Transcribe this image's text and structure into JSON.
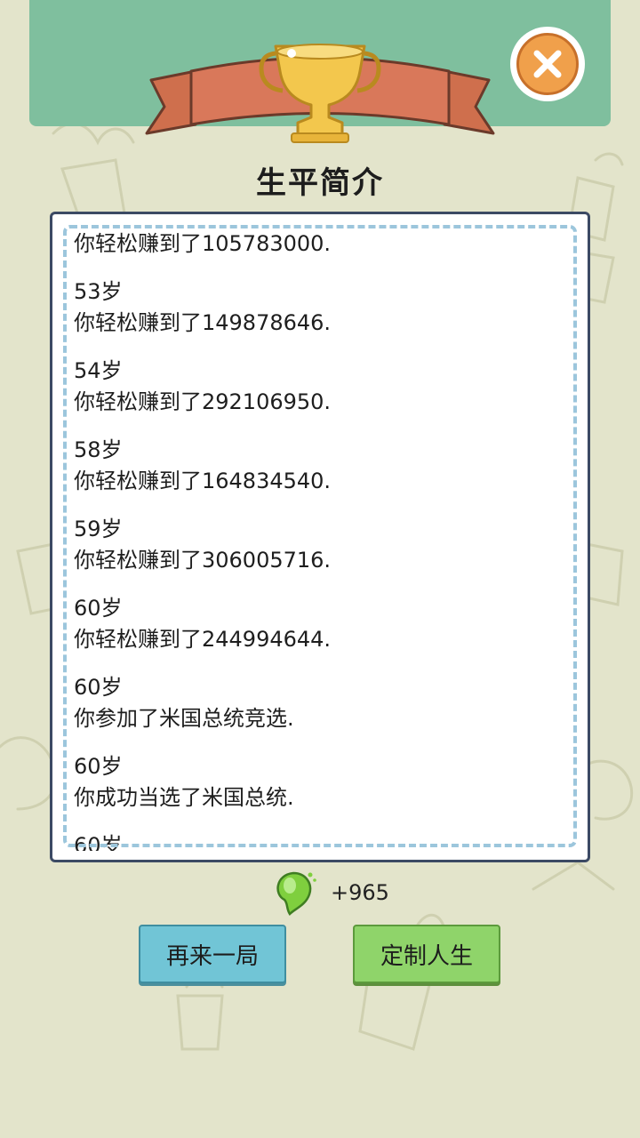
{
  "header": {
    "title": "生平简介"
  },
  "timeline": [
    {
      "age": "",
      "event": "你轻松赚到了105783000."
    },
    {
      "age": "53岁",
      "event": "你轻松赚到了149878646."
    },
    {
      "age": "54岁",
      "event": "你轻松赚到了292106950."
    },
    {
      "age": "58岁",
      "event": "你轻松赚到了164834540."
    },
    {
      "age": "59岁",
      "event": "你轻松赚到了306005716."
    },
    {
      "age": "60岁",
      "event": "你轻松赚到了244994644."
    },
    {
      "age": "60岁",
      "event": "你参加了米国总统竞选."
    },
    {
      "age": "60岁",
      "event": "你成功当选了米国总统."
    },
    {
      "age": "60岁",
      "event": ""
    }
  ],
  "reward": {
    "value": "+965",
    "icon": "green-bean-icon"
  },
  "buttons": {
    "restart_label": "再来一局",
    "customize_label": "定制人生"
  },
  "colors": {
    "header_bg": "#7fbf9e",
    "page_bg": "#e3e4cb",
    "restart_button": "#71c5d6",
    "customize_button": "#8fd46a",
    "close_button": "#f0a04b"
  }
}
